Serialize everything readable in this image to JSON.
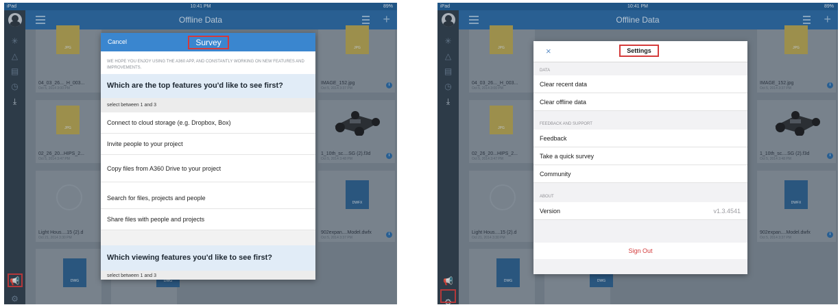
{
  "status_bar": {
    "device": "iPad",
    "time": "10:41 PM",
    "battery": "89%"
  },
  "nav": {
    "title": "Offline Data"
  },
  "tiles": {
    "file1": {
      "name": "04_03_26..._H_003...",
      "date": "Oct 5, 2014 3:00 PM"
    },
    "file2": {
      "name": "IMAGE_152.jpg",
      "date": "Oct 5, 2014 3:37 PM"
    },
    "file3": {
      "name": "02_26_20...HIPS_2...",
      "date": "Oct 5, 2014 3:47 PM"
    },
    "file4": {
      "name": "1_10th_sc....SG (2).f3d",
      "date": "Oct 5, 2014 3:48 PM"
    },
    "file5": {
      "name": "Light Hous....15 (2).d",
      "date": "Oct 21, 2014 3:30 PM"
    },
    "file6": {
      "name": "902expan....Model.dwfx",
      "date": "Oct 5, 2014 3:37 PM"
    },
    "badges": {
      "jpg": "JPG",
      "dwfx": "DWFX",
      "dwg": "DWG"
    }
  },
  "survey": {
    "cancel_label": "Cancel",
    "title": "Survey",
    "intro": "WE HOPE YOU ENJOY USING THE A360 APP, AND CONSTANTLY WORKING ON NEW FEATURES AND IMPROVEMENTS.",
    "q1": {
      "text": "Which are the top features you'd like to see first?",
      "hint": "select between 1 and 3",
      "options": [
        "Connect to cloud storage (e.g. Dropbox, Box)",
        "Invite people to your project",
        "Copy files from A360 Drive to your project",
        "Search for files, projects and people",
        "Share files with people and projects"
      ]
    },
    "q2": {
      "text": "Which viewing features you'd like to see first?",
      "hint": "select between 1 and 3"
    }
  },
  "settings": {
    "close_label": "×",
    "title": "Settings",
    "sections": {
      "data": "DATA",
      "feedback": "FEEDBACK AND SUPPORT",
      "about": "ABOUT"
    },
    "rows": {
      "clear_recent": "Clear recent data",
      "clear_offline": "Clear offline data",
      "feedback": "Feedback",
      "survey": "Take a quick survey",
      "community": "Community",
      "version_label": "Version",
      "version_value": "v1.3.4541"
    },
    "sign_out": "Sign Out"
  },
  "colors": {
    "nav": "#2a6aa5",
    "sidebar": "#2f3e4b",
    "survey_header": "#3a86cf",
    "highlight": "#d43a3a",
    "sign_out": "#d33b3b"
  }
}
